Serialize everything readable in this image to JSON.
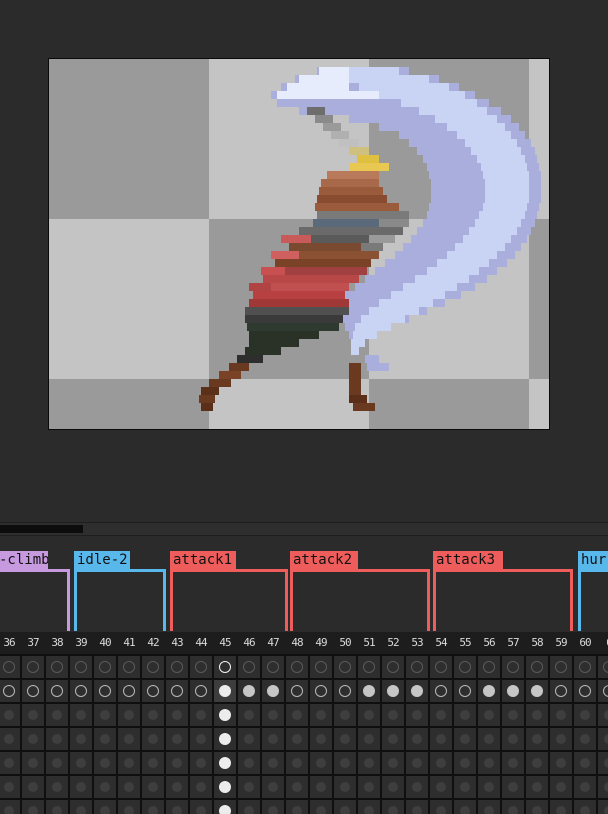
{
  "editor": {
    "canvas": {
      "sprite": "knight-sword-slash",
      "checker_colors": [
        "#9a9a9a",
        "#c4c4c4",
        "#d0d0d0"
      ]
    },
    "scrollbar_icon": "horizontal-scrollbar",
    "tags": [
      {
        "label": "-climb",
        "color": "#c79ae0"
      },
      {
        "label": "idle-2",
        "color": "#58b8ec"
      },
      {
        "label": "attack1",
        "color": "#ee5c5c"
      },
      {
        "label": "attack2",
        "color": "#ee5c5c"
      },
      {
        "label": "attack3",
        "color": "#ee5c5c"
      },
      {
        "label": "hur",
        "color": "#58b8ec"
      }
    ],
    "frames": [
      "36",
      "37",
      "38",
      "39",
      "40",
      "41",
      "42",
      "43",
      "44",
      "45",
      "46",
      "47",
      "48",
      "49",
      "50",
      "51",
      "52",
      "53",
      "54",
      "55",
      "56",
      "57",
      "58",
      "59",
      "60",
      "6"
    ],
    "current_frame": "45",
    "layers": 7
  }
}
